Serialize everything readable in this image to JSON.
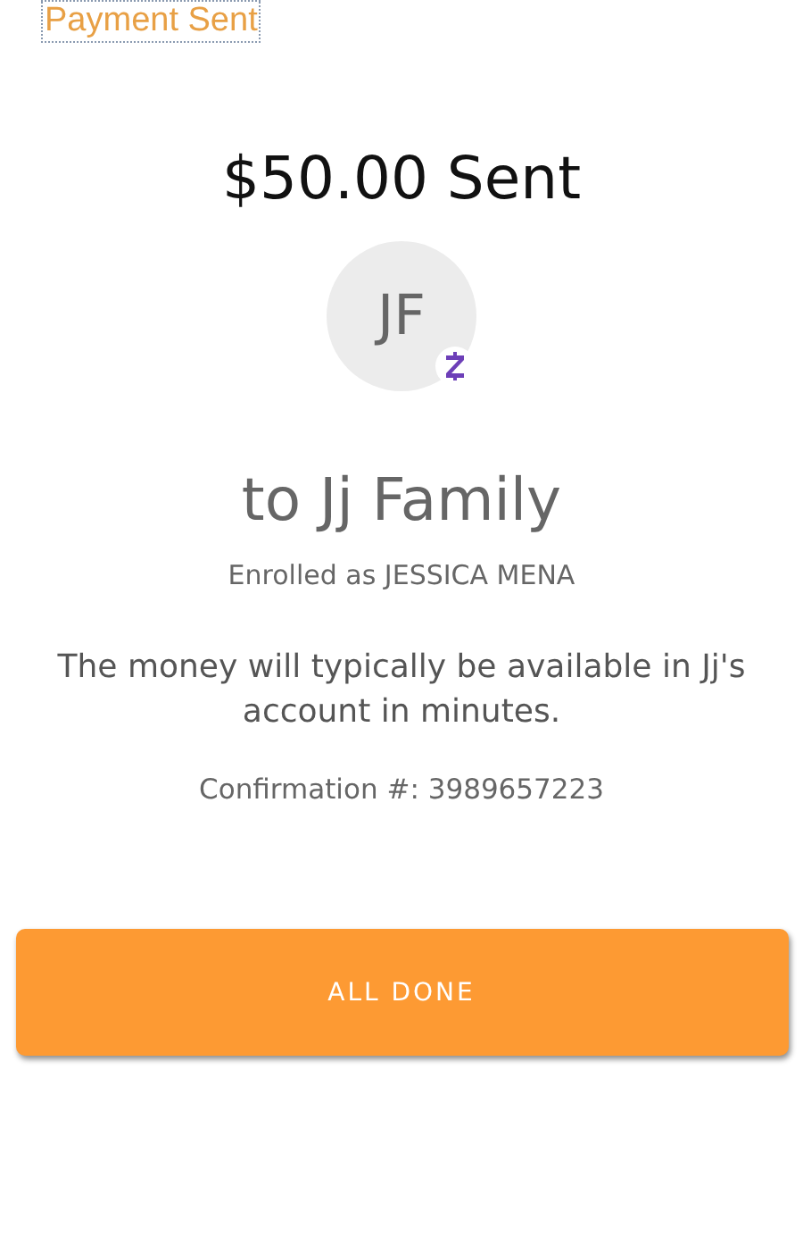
{
  "header": {
    "title": "Payment Sent"
  },
  "amount": "$50.00 Sent",
  "recipient": {
    "initials": "JF",
    "name": "to Jj Family",
    "enrolled": "Enrolled as JESSICA MENA"
  },
  "message": "The money will typically be available in Jj's account in minutes.",
  "confirmation": "Confirmation #: 3989657223",
  "button": {
    "label": "ALL DONE"
  }
}
